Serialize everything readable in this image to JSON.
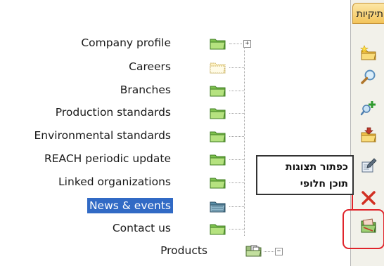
{
  "panel": {
    "tab_label": "תיקיות",
    "tools": [
      {
        "icon": "new-folder-icon"
      },
      {
        "icon": "search-icon"
      },
      {
        "icon": "add-item-icon"
      },
      {
        "icon": "move-folder-icon"
      },
      {
        "icon": "edit-properties-icon"
      },
      {
        "icon": "delete-icon"
      },
      {
        "icon": "alternate-content-folder-icon"
      }
    ]
  },
  "tree": {
    "items": [
      {
        "label": "Company profile",
        "expander": "+"
      },
      {
        "label": "Careers"
      },
      {
        "label": "Branches"
      },
      {
        "label": "Production standards"
      },
      {
        "label": "Environmental standards"
      },
      {
        "label": "REACH periodic update"
      },
      {
        "label": "Linked organizations"
      },
      {
        "label": "News & events",
        "selected": true
      },
      {
        "label": "Contact us"
      },
      {
        "label": "Products",
        "expander": "−"
      }
    ]
  },
  "callout": {
    "line1": "כפתור תצוגות",
    "line2": "תוכן חלופי"
  },
  "colors": {
    "selection": "#316ac5",
    "highlight": "#e0242b",
    "folder": "#9bd36a"
  }
}
